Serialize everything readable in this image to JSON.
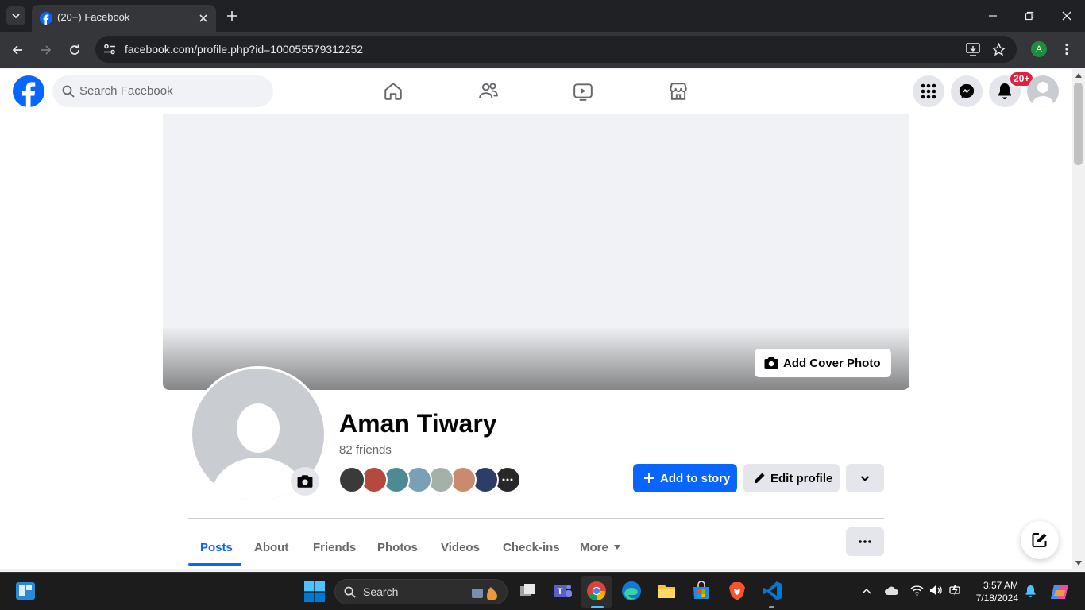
{
  "browser": {
    "tab_title": "(20+) Facebook",
    "url": "facebook.com/profile.php?id=100055579312252",
    "profile_initial": "A"
  },
  "fb": {
    "search_placeholder": "Search Facebook",
    "notification_badge": "20+"
  },
  "profile": {
    "name": "Aman Tiwary",
    "friends_count": "82 friends",
    "add_cover_label": "Add Cover Photo",
    "add_story_label": "Add to story",
    "edit_profile_label": "Edit profile",
    "friend_avatar_colors": [
      "#3a3a3a",
      "#b5483f",
      "#4d8a96",
      "#7aa0b5",
      "#a5b0a8",
      "#c98a6e",
      "#2c3e68",
      "#282828"
    ]
  },
  "tabs": [
    "Posts",
    "About",
    "Friends",
    "Photos",
    "Videos",
    "Check-ins",
    "More"
  ],
  "taskbar": {
    "search_label": "Search",
    "time": "3:57 AM",
    "date": "7/18/2024"
  },
  "colors": {
    "fb_blue": "#0866ff",
    "badge_red": "#e41e3f"
  }
}
